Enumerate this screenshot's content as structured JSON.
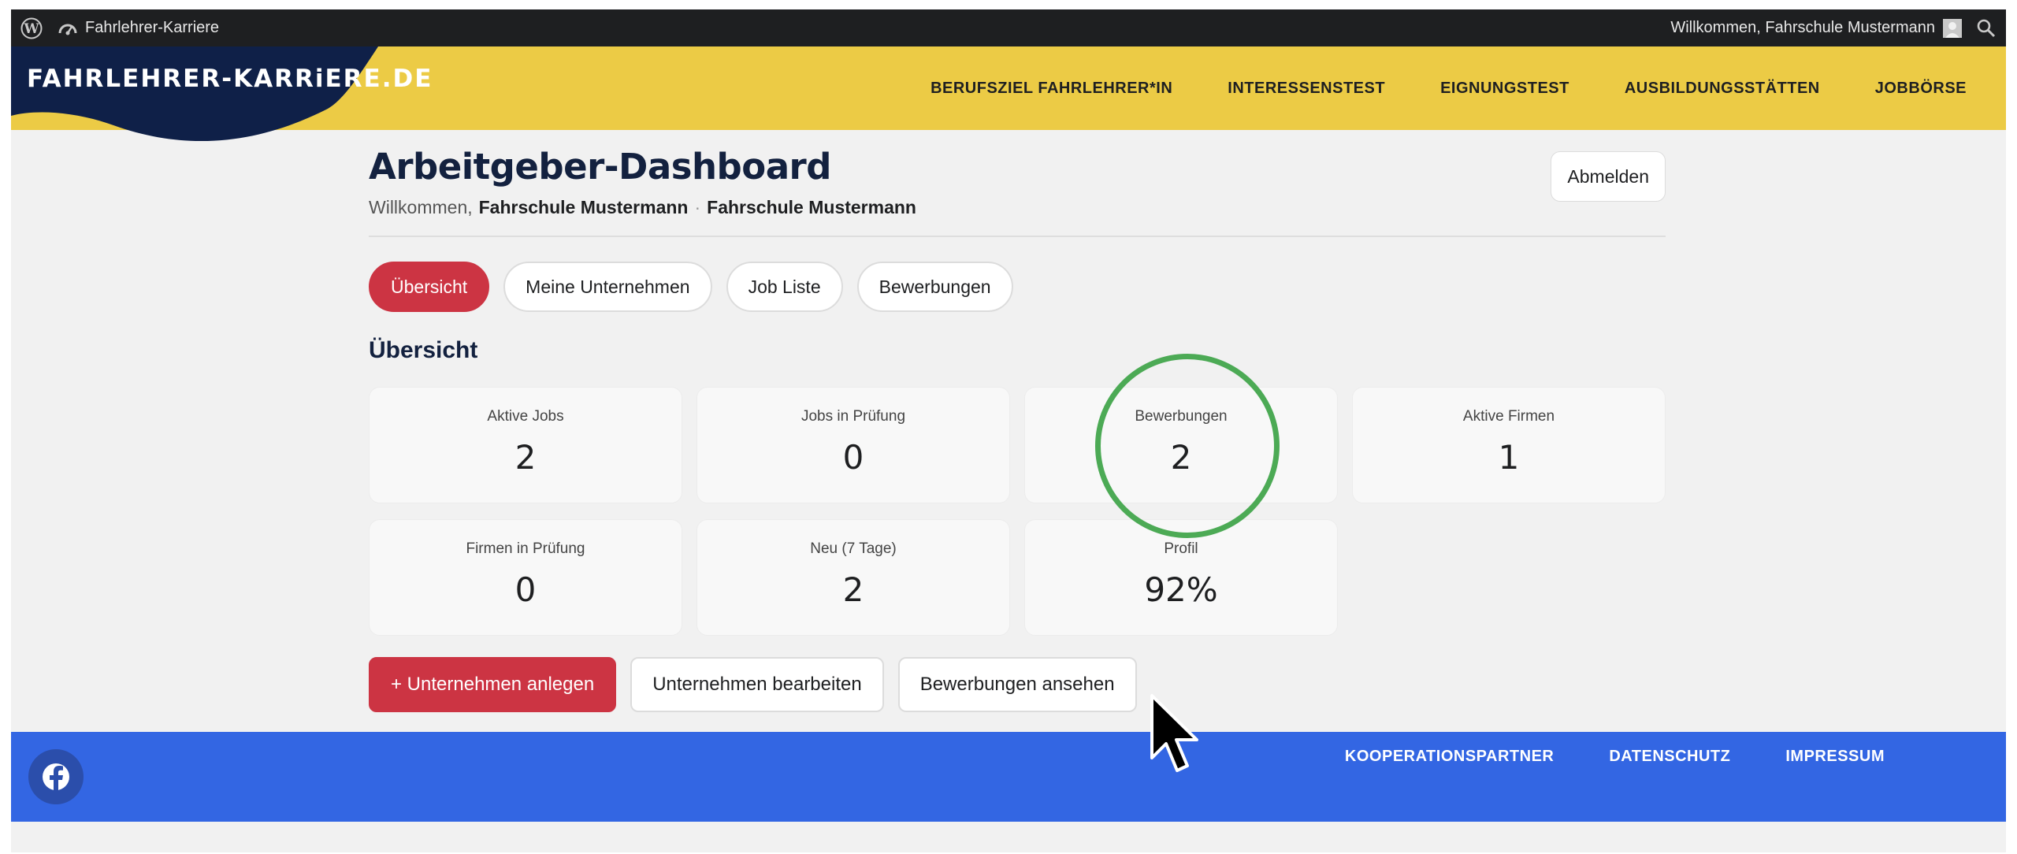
{
  "adminbar": {
    "site_name": "Fahrlehrer-Karriere",
    "greeting": "Willkommen, Fahrschule Mustermann"
  },
  "header": {
    "logo_text": "FAHRLEHRER-KARRiERE.DE",
    "nav": [
      "BERUFSZIEL FAHRLEHRER*IN",
      "INTERESSENSTEST",
      "EIGNUNGSTEST",
      "AUSBILDUNGSSTÄTTEN",
      "JOBBÖRSE"
    ]
  },
  "dashboard": {
    "title": "Arbeitgeber-Dashboard",
    "welcome_prefix": "Willkommen,",
    "user_name": "Fahrschule Mustermann",
    "separator": "·",
    "company_name": "Fahrschule Mustermann",
    "logout_label": "Abmelden",
    "tabs": [
      "Übersicht",
      "Meine Unternehmen",
      "Job Liste",
      "Bewerbungen"
    ],
    "active_tab": "Übersicht",
    "section_title": "Übersicht",
    "stats": [
      {
        "label": "Aktive Jobs",
        "value": "2"
      },
      {
        "label": "Jobs in Prüfung",
        "value": "0"
      },
      {
        "label": "Bewerbungen",
        "value": "2"
      },
      {
        "label": "Aktive Firmen",
        "value": "1"
      },
      {
        "label": "Firmen in Prüfung",
        "value": "0"
      },
      {
        "label": "Neu (7 Tage)",
        "value": "2"
      },
      {
        "label": "Profil",
        "value": "92%"
      }
    ],
    "actions": [
      "+ Unternehmen anlegen",
      "Unternehmen bearbeiten",
      "Bewerbungen ansehen"
    ]
  },
  "footer": {
    "links": [
      "KOOPERATIONSPARTNER",
      "DATENSCHUTZ",
      "IMPRESSUM"
    ]
  },
  "colors": {
    "header_yellow": "#eccb45",
    "logo_navy": "#0f2048",
    "accent_red": "#cc3443",
    "footer_blue": "#3366e3",
    "highlight_green": "#4caa55"
  }
}
